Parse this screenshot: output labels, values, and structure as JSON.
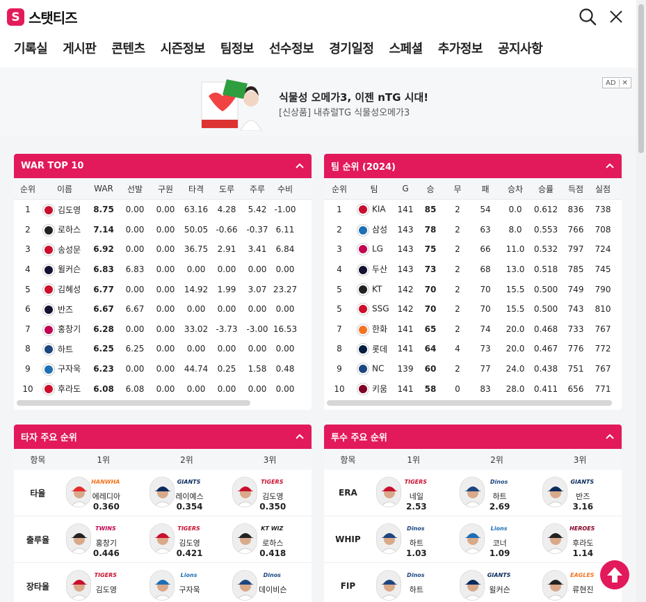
{
  "header": {
    "logo_mark": "S",
    "logo_text": "스탯티즈",
    "nav": [
      "기록실",
      "게시판",
      "콘텐츠",
      "시즌정보",
      "팀정보",
      "선수정보",
      "경기일정",
      "스페셜",
      "추가정보",
      "공지사항"
    ]
  },
  "ad": {
    "title": "식물성 오메가3, 이젠 nTG 시대!",
    "subtitle": "[신상품] 내츄럴TG 식물성오메가3",
    "badge": "AD",
    "close": "✕",
    "product_tag": "식물성 100%"
  },
  "war": {
    "title": "WAR TOP 10",
    "columns": [
      "순위",
      "이름",
      "WAR",
      "선발",
      "구원",
      "타격",
      "도루",
      "주루",
      "수비"
    ],
    "rows": [
      {
        "rank": "1",
        "team": "KIA",
        "name": "김도영",
        "war": "8.75",
        "sp": "0.00",
        "rp": "0.00",
        "bat": "63.16",
        "sb": "4.28",
        "run": "5.42",
        "def": "-1.00"
      },
      {
        "rank": "2",
        "team": "KT",
        "name": "로하스",
        "war": "7.14",
        "sp": "0.00",
        "rp": "0.00",
        "bat": "50.05",
        "sb": "-0.66",
        "run": "-0.37",
        "def": "6.11"
      },
      {
        "rank": "3",
        "team": "SSG",
        "name": "송성문",
        "war": "6.92",
        "sp": "0.00",
        "rp": "0.00",
        "bat": "36.75",
        "sb": "2.91",
        "run": "3.41",
        "def": "6.84"
      },
      {
        "rank": "4",
        "team": "DOO",
        "name": "윌커슨",
        "war": "6.83",
        "sp": "6.83",
        "rp": "0.00",
        "bat": "0.00",
        "sb": "0.00",
        "run": "0.00",
        "def": "0.00"
      },
      {
        "rank": "5",
        "team": "SSG",
        "name": "김혜성",
        "war": "6.77",
        "sp": "0.00",
        "rp": "0.00",
        "bat": "14.92",
        "sb": "1.99",
        "run": "3.07",
        "def": "23.27"
      },
      {
        "rank": "6",
        "team": "DOO",
        "name": "반즈",
        "war": "6.67",
        "sp": "6.67",
        "rp": "0.00",
        "bat": "0.00",
        "sb": "0.00",
        "run": "0.00",
        "def": "0.00"
      },
      {
        "rank": "7",
        "team": "LG",
        "name": "홍창기",
        "war": "6.28",
        "sp": "0.00",
        "rp": "0.00",
        "bat": "33.02",
        "sb": "-3.73",
        "run": "-3.00",
        "def": "16.53"
      },
      {
        "rank": "8",
        "team": "NC",
        "name": "하트",
        "war": "6.25",
        "sp": "6.25",
        "rp": "0.00",
        "bat": "0.00",
        "sb": "0.00",
        "run": "0.00",
        "def": "0.00"
      },
      {
        "rank": "9",
        "team": "SAM",
        "name": "구자욱",
        "war": "6.23",
        "sp": "0.00",
        "rp": "0.00",
        "bat": "44.74",
        "sb": "0.25",
        "run": "1.58",
        "def": "0.48"
      },
      {
        "rank": "10",
        "team": "SSG",
        "name": "후라도",
        "war": "6.08",
        "sp": "6.08",
        "rp": "0.00",
        "bat": "0.00",
        "sb": "0.00",
        "run": "0.00",
        "def": "0.00"
      }
    ]
  },
  "standings": {
    "title": "팀 순위 (2024)",
    "columns": [
      "순위",
      "팀",
      "G",
      "승",
      "무",
      "패",
      "승차",
      "승률",
      "득점",
      "실점"
    ],
    "rows": [
      {
        "rank": "1",
        "team": "KIA",
        "g": "141",
        "w": "85",
        "d": "2",
        "l": "54",
        "gb": "0.0",
        "pct": "0.612",
        "rs": "836",
        "ra": "738"
      },
      {
        "rank": "2",
        "team": "삼성",
        "g": "143",
        "w": "78",
        "d": "2",
        "l": "63",
        "gb": "8.0",
        "pct": "0.553",
        "rs": "766",
        "ra": "708"
      },
      {
        "rank": "3",
        "team": "LG",
        "g": "143",
        "w": "75",
        "d": "2",
        "l": "66",
        "gb": "11.0",
        "pct": "0.532",
        "rs": "797",
        "ra": "724"
      },
      {
        "rank": "4",
        "team": "두산",
        "g": "143",
        "w": "73",
        "d": "2",
        "l": "68",
        "gb": "13.0",
        "pct": "0.518",
        "rs": "785",
        "ra": "745"
      },
      {
        "rank": "5",
        "team": "KT",
        "g": "142",
        "w": "70",
        "d": "2",
        "l": "70",
        "gb": "15.5",
        "pct": "0.500",
        "rs": "749",
        "ra": "790"
      },
      {
        "rank": "5",
        "team": "SSG",
        "g": "142",
        "w": "70",
        "d": "2",
        "l": "70",
        "gb": "15.5",
        "pct": "0.500",
        "rs": "743",
        "ra": "810"
      },
      {
        "rank": "7",
        "team": "한화",
        "g": "141",
        "w": "65",
        "d": "2",
        "l": "74",
        "gb": "20.0",
        "pct": "0.468",
        "rs": "733",
        "ra": "767"
      },
      {
        "rank": "8",
        "team": "롯데",
        "g": "141",
        "w": "64",
        "d": "4",
        "l": "73",
        "gb": "20.0",
        "pct": "0.467",
        "rs": "776",
        "ra": "772"
      },
      {
        "rank": "9",
        "team": "NC",
        "g": "139",
        "w": "60",
        "d": "2",
        "l": "77",
        "gb": "24.0",
        "pct": "0.438",
        "rs": "751",
        "ra": "767"
      },
      {
        "rank": "10",
        "team": "키움",
        "g": "141",
        "w": "58",
        "d": "0",
        "l": "83",
        "gb": "28.0",
        "pct": "0.411",
        "rs": "656",
        "ra": "771"
      }
    ]
  },
  "batting": {
    "title": "타자 주요 순위",
    "columns": [
      "항목",
      "1위",
      "2위",
      "3위"
    ],
    "rows": [
      {
        "label": "타율",
        "players": [
          {
            "logo": "HANWHA",
            "logo_color": "#f37321",
            "name": "에레디아",
            "value": "0.360",
            "cap": "#e52b2b"
          },
          {
            "logo": "GIANTS",
            "logo_color": "#0a2b5c",
            "name": "레이예스",
            "value": "0.354",
            "cap": "#0a2b5c"
          },
          {
            "logo": "TIGERS",
            "logo_color": "#c8102e",
            "name": "김도영",
            "value": "0.350",
            "cap": "#c8102e"
          }
        ]
      },
      {
        "label": "출루율",
        "players": [
          {
            "logo": "TWINS",
            "logo_color": "#c30452",
            "name": "홍창기",
            "value": "0.446",
            "cap": "#222"
          },
          {
            "logo": "TIGERS",
            "logo_color": "#c8102e",
            "name": "김도영",
            "value": "0.421",
            "cap": "#c8102e"
          },
          {
            "logo": "KT WIZ",
            "logo_color": "#222",
            "name": "로하스",
            "value": "0.418",
            "cap": "#222"
          }
        ]
      },
      {
        "label": "장타율",
        "players": [
          {
            "logo": "TIGERS",
            "logo_color": "#c8102e",
            "name": "김도영",
            "value": "",
            "cap": "#c8102e"
          },
          {
            "logo": "Lions",
            "logo_color": "#1f6fb5",
            "name": "구자욱",
            "value": "",
            "cap": "#1f6fb5"
          },
          {
            "logo": "Dinos",
            "logo_color": "#1d467f",
            "name": "데이비슨",
            "value": "",
            "cap": "#1d467f"
          }
        ]
      }
    ]
  },
  "pitching": {
    "title": "투수 주요 순위",
    "columns": [
      "항목",
      "1위",
      "2위",
      "3위"
    ],
    "rows": [
      {
        "label": "ERA",
        "players": [
          {
            "logo": "TIGERS",
            "logo_color": "#c8102e",
            "name": "네일",
            "value": "2.53",
            "cap": "#c8102e"
          },
          {
            "logo": "Dinos",
            "logo_color": "#1d467f",
            "name": "하트",
            "value": "2.69",
            "cap": "#1d467f"
          },
          {
            "logo": "GIANTS",
            "logo_color": "#0a2b5c",
            "name": "반즈",
            "value": "3.16",
            "cap": "#0a2b5c"
          }
        ]
      },
      {
        "label": "WHIP",
        "players": [
          {
            "logo": "Dinos",
            "logo_color": "#1d467f",
            "name": "하트",
            "value": "1.03",
            "cap": "#1d467f"
          },
          {
            "logo": "Lions",
            "logo_color": "#1f6fb5",
            "name": "코너",
            "value": "1.09",
            "cap": "#1f6fb5"
          },
          {
            "logo": "HEROES",
            "logo_color": "#820024",
            "name": "후라도",
            "value": "1.14",
            "cap": "#222"
          }
        ]
      },
      {
        "label": "FIP",
        "players": [
          {
            "logo": "Dinos",
            "logo_color": "#1d467f",
            "name": "하트",
            "value": "",
            "cap": "#1d467f"
          },
          {
            "logo": "GIANTS",
            "logo_color": "#0a2b5c",
            "name": "윌커슨",
            "value": "",
            "cap": "#0a2b5c"
          },
          {
            "logo": "EAGLES",
            "logo_color": "#f37321",
            "name": "류현진",
            "value": "",
            "cap": "#222"
          }
        ]
      }
    ]
  },
  "colors": {
    "brand": "#e2195b",
    "header_text": "#ffffff",
    "page_bg": "#f4f5f7"
  },
  "team_colors": {
    "KIA": "#c8102e",
    "KT": "#222222",
    "SSG": "#ce0e2d",
    "DOO": "#131230",
    "LG": "#c30452",
    "NC": "#1d467f",
    "SAM": "#1f6fb5",
    "삼성": "#1f6fb5",
    "두산": "#131230",
    "한화": "#f37321",
    "롯데": "#041e42",
    "키움": "#820024"
  }
}
